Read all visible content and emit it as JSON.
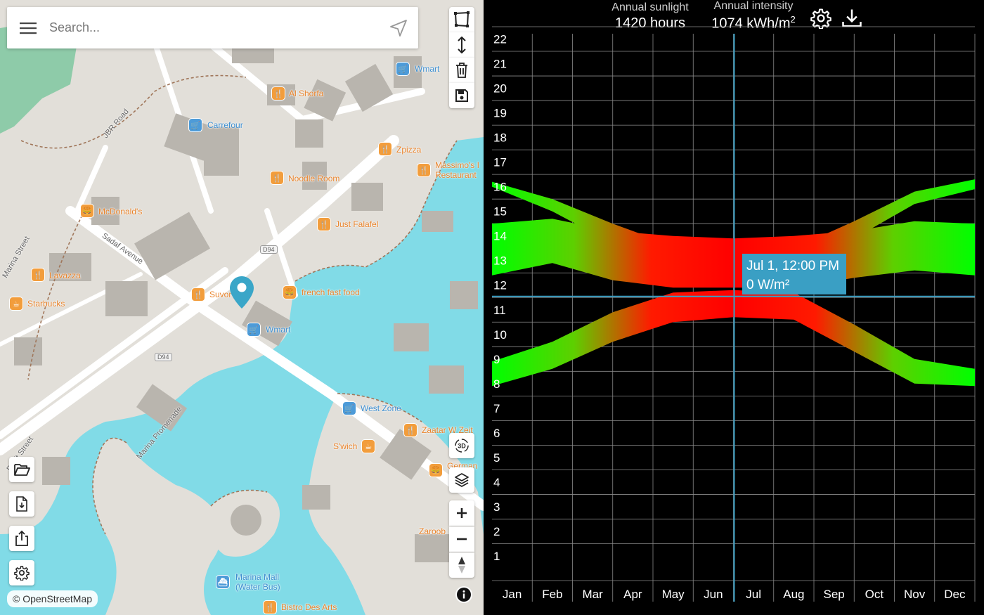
{
  "search": {
    "placeholder": "Search..."
  },
  "map": {
    "attribution": "© OpenStreetMap",
    "pois": [
      {
        "name": "Al Shorfa",
        "kind": "food"
      },
      {
        "name": "Carrefour",
        "kind": "shop"
      },
      {
        "name": "Zpizza",
        "kind": "food"
      },
      {
        "name": "Massimo's I Restaurant",
        "kind": "food"
      },
      {
        "name": "Noodle Room",
        "kind": "food"
      },
      {
        "name": "McDonald's",
        "kind": "food"
      },
      {
        "name": "Just Falafel",
        "kind": "food"
      },
      {
        "name": "Lavazza",
        "kind": "food"
      },
      {
        "name": "Starbucks",
        "kind": "food"
      },
      {
        "name": "Suvor",
        "kind": "food"
      },
      {
        "name": "french fast food",
        "kind": "food"
      },
      {
        "name": "Wmart",
        "kind": "shop"
      },
      {
        "name": "West Zone",
        "kind": "shop"
      },
      {
        "name": "Zaatar W Zeit",
        "kind": "food"
      },
      {
        "name": "S'wich",
        "kind": "food"
      },
      {
        "name": "German",
        "kind": "food"
      },
      {
        "name": "Zaroob",
        "kind": "food"
      },
      {
        "name": "Marina Mall (Water Bus)",
        "kind": "shop"
      },
      {
        "name": "Bistro Des Arts",
        "kind": "food"
      },
      {
        "name": "Wmart",
        "kind": "shop"
      }
    ],
    "roads": [
      "JBR Road",
      "Sadaf Avenue",
      "Marina Promenade",
      "D94",
      "D94",
      "Marina Street",
      "Dusit Street"
    ]
  },
  "map_icons": {
    "top_right": [
      "polygon-icon",
      "height-icon",
      "trash-icon",
      "save-icon"
    ],
    "left": [
      "folder-open-icon",
      "file-download-icon",
      "share-icon",
      "settings-icon"
    ],
    "right_bottom": [
      "3d-icon",
      "layers-icon",
      "zoom-in-icon",
      "zoom-out-icon",
      "compass-icon",
      "info-icon"
    ]
  },
  "stats": {
    "sunlight_label": "Annual sunlight",
    "sunlight_value": "1420 hours",
    "intensity_label": "Annual intensity",
    "intensity_value": "1074 kWh/m",
    "intensity_sup": "2"
  },
  "tooltip": {
    "line1": "Jul 1, 12:00 PM",
    "line2": "0 W/m²"
  },
  "colors": {
    "low": "#00ff00",
    "high": "#ff0000",
    "cursor": "#3a9fc4",
    "tooltip_bg": "#3a9fc4",
    "water": "#81dbe7"
  },
  "chart_data": {
    "type": "heatmap",
    "categories": [
      "Jan",
      "Feb",
      "Mar",
      "Apr",
      "May",
      "Jun",
      "Jul",
      "Aug",
      "Sep",
      "Oct",
      "Nov",
      "Dec"
    ],
    "y_ticks": [
      1,
      2,
      3,
      4,
      5,
      6,
      7,
      8,
      9,
      10,
      11,
      12,
      13,
      14,
      15,
      16,
      17,
      18,
      19,
      20,
      21,
      22
    ],
    "ylim": [
      0,
      22.5
    ],
    "grid": true,
    "cursor": {
      "month": "Jul",
      "hour": 12
    },
    "description_bands": [
      {
        "name": "",
        "months": [
          0,
          1.5,
          3,
          4.5,
          6,
          7.5,
          9,
          10.5,
          12
        ],
        "lower": [
          12.4,
          12.9,
          12.2,
          11.9,
          11.9,
          11.9,
          12.3,
          12.6,
          12.4
        ],
        "upper": [
          14.5,
          14.7,
          14.2,
          14.0,
          13.9,
          14.0,
          14.2,
          14.6,
          14.5
        ]
      },
      {
        "name": "",
        "months": [
          0,
          1.5,
          3,
          4.5,
          6,
          7.5,
          9,
          10.5,
          12
        ],
        "lower": [
          16.0,
          15.0,
          13.7,
          13.1,
          13.0,
          13.0,
          13.9,
          15.3,
          15.9
        ],
        "upper": [
          16.2,
          15.5,
          14.5,
          13.6,
          13.7,
          13.5,
          14.6,
          15.8,
          16.3
        ]
      },
      {
        "name": "",
        "months": [
          0,
          1.5,
          3,
          4.5,
          6,
          7.5,
          9,
          10.5,
          12
        ],
        "lower": [
          7.9,
          8.6,
          9.7,
          10.5,
          10.7,
          10.6,
          9.3,
          8.0,
          7.9
        ],
        "upper": [
          8.9,
          9.7,
          10.9,
          11.7,
          11.8,
          11.7,
          10.4,
          9.0,
          8.6
        ]
      }
    ]
  }
}
